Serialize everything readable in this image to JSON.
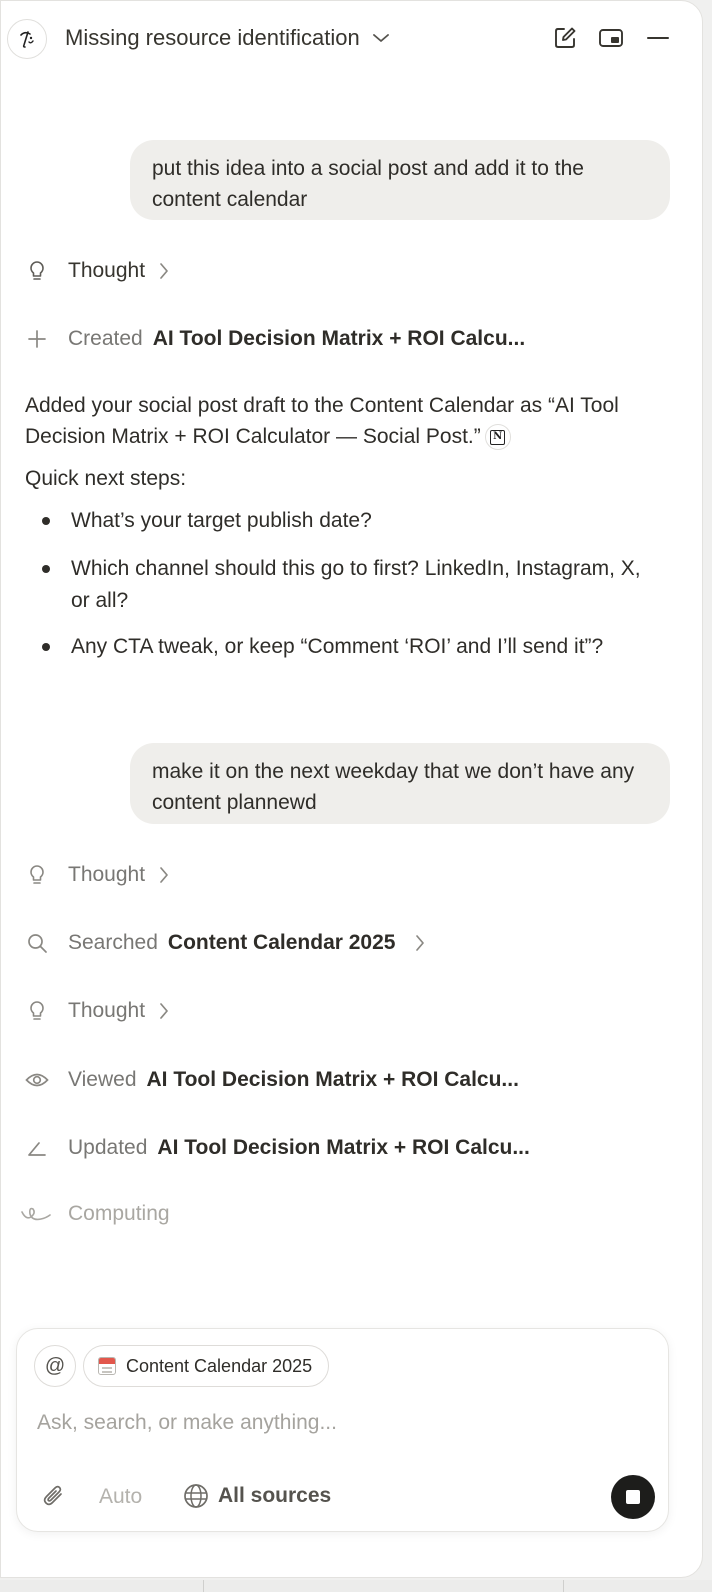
{
  "header": {
    "title": "Missing resource identification"
  },
  "messages": {
    "user_1": "put this idea into a social post and add it to the content calendar",
    "user_2": "make it on the next weekday that we don’t have any content plannewd"
  },
  "steps_1": [
    {
      "icon": "lightbulb-icon",
      "verb": "Thought",
      "object": ""
    },
    {
      "icon": "plus-icon",
      "verb": "Created",
      "object": "AI Tool Decision Matrix + ROI Calcu..."
    }
  ],
  "response": {
    "text": "Added your social post draft to the Content Calendar as “AI Tool Decision Matrix + ROI Calculator — Social Post.”",
    "badge": "N",
    "next_steps_heading": "Quick next steps:",
    "bullets": [
      "What’s your target publish date?",
      "Which channel should this go to first? LinkedIn, Instagram, X, or all?",
      "Any CTA tweak, or keep “Comment ‘ROI’ and I’ll send it”?"
    ]
  },
  "steps_2": [
    {
      "icon": "lightbulb-icon",
      "verb": "Thought",
      "object": ""
    },
    {
      "icon": "search-icon",
      "verb": "Searched",
      "object": "Content Calendar 2025"
    },
    {
      "icon": "lightbulb-icon",
      "verb": "Thought",
      "object": ""
    },
    {
      "icon": "eye-icon",
      "verb": "Viewed",
      "object": "AI Tool Decision Matrix + ROI Calcu..."
    },
    {
      "icon": "pencil-icon",
      "verb": "Updated",
      "object": "AI Tool Decision Matrix + ROI Calcu..."
    }
  ],
  "status": {
    "label": "Computing"
  },
  "composer": {
    "at_label": "@",
    "context_chip": "Content Calendar 2025",
    "placeholder": "Ask, search, or make anything...",
    "model_label": "Auto",
    "sources_label": "All sources"
  },
  "colors": {
    "bubble": "#efeeeb",
    "muted_text": "#787774",
    "text": "#2f2d29",
    "stop_button": "#1d1d1b"
  }
}
